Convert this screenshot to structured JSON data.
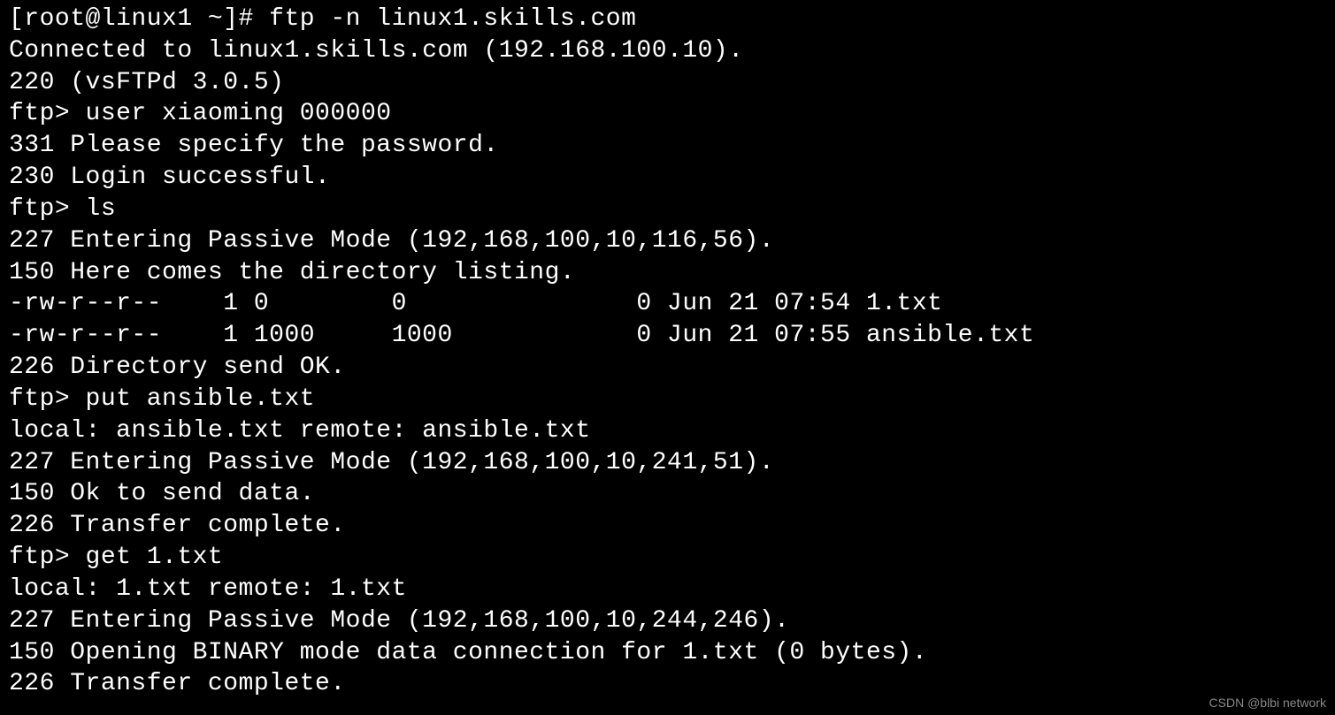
{
  "terminal": {
    "lines": [
      "[root@linux1 ~]# ftp -n linux1.skills.com",
      "Connected to linux1.skills.com (192.168.100.10).",
      "220 (vsFTPd 3.0.5)",
      "ftp> user xiaoming 000000",
      "331 Please specify the password.",
      "230 Login successful.",
      "ftp> ls",
      "227 Entering Passive Mode (192,168,100,10,116,56).",
      "150 Here comes the directory listing.",
      "-rw-r--r--    1 0        0               0 Jun 21 07:54 1.txt",
      "-rw-r--r--    1 1000     1000            0 Jun 21 07:55 ansible.txt",
      "226 Directory send OK.",
      "ftp> put ansible.txt",
      "local: ansible.txt remote: ansible.txt",
      "227 Entering Passive Mode (192,168,100,10,241,51).",
      "150 Ok to send data.",
      "226 Transfer complete.",
      "ftp> get 1.txt",
      "local: 1.txt remote: 1.txt",
      "227 Entering Passive Mode (192,168,100,10,244,246).",
      "150 Opening BINARY mode data connection for 1.txt (0 bytes).",
      "226 Transfer complete."
    ]
  },
  "watermark": "CSDN @blbi network"
}
